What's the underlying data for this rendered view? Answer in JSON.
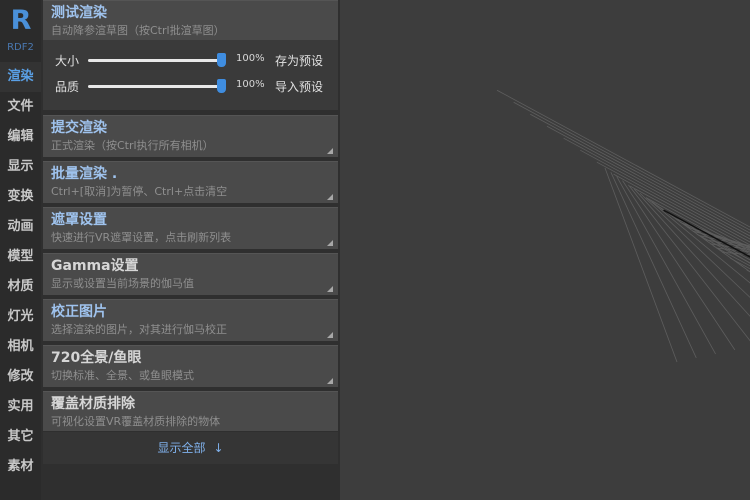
{
  "logo": {
    "letter": "R",
    "sub": "RDF2"
  },
  "sidebar": {
    "items": [
      {
        "label": "渲染"
      },
      {
        "label": "文件"
      },
      {
        "label": "编辑"
      },
      {
        "label": "显示"
      },
      {
        "label": "变换"
      },
      {
        "label": "动画"
      },
      {
        "label": "模型"
      },
      {
        "label": "材质"
      },
      {
        "label": "灯光"
      },
      {
        "label": "相机"
      },
      {
        "label": "修改"
      },
      {
        "label": "实用"
      },
      {
        "label": "其它"
      },
      {
        "label": "素材"
      }
    ],
    "active_index": 0
  },
  "test_render": {
    "title": "测试渲染",
    "desc": "自动降参渲草图（按Ctrl批渲草图）"
  },
  "sliders": {
    "size": {
      "label": "大小",
      "value": "100%",
      "fraction": 1.0,
      "action": "存为预设"
    },
    "quality": {
      "label": "品质",
      "value": "100%",
      "fraction": 1.0,
      "action": "导入预设"
    }
  },
  "sections": [
    {
      "title": "提交渲染",
      "desc": "正式渲染（按Ctrl执行所有相机）",
      "plain": false
    },
    {
      "title": "批量渲染 .",
      "desc": "Ctrl+[取消]为暂停、Ctrl+点击清空",
      "plain": false
    },
    {
      "title": "遮罩设置",
      "desc": "快速进行VR遮罩设置，点击刷新列表",
      "plain": false
    },
    {
      "title": "Gamma设置",
      "desc": "显示或设置当前场景的伽马值",
      "plain": true
    },
    {
      "title": "校正图片",
      "desc": "选择渲染的图片，对其进行伽马校正",
      "plain": false
    },
    {
      "title": "720全景/鱼眼",
      "desc": "切换标准、全景、或鱼眼模式",
      "plain": true
    },
    {
      "title": "覆盖材质排除",
      "desc": "可视化设置VR覆盖材质排除的物体",
      "plain": true
    }
  ],
  "show_all": {
    "label": "显示全部",
    "arrow": "↓"
  },
  "colors": {
    "accent": "#4a90d9",
    "panel": "#4a4a4a",
    "viewport": "#3d3d3d",
    "grid": "#5e5e5e"
  }
}
